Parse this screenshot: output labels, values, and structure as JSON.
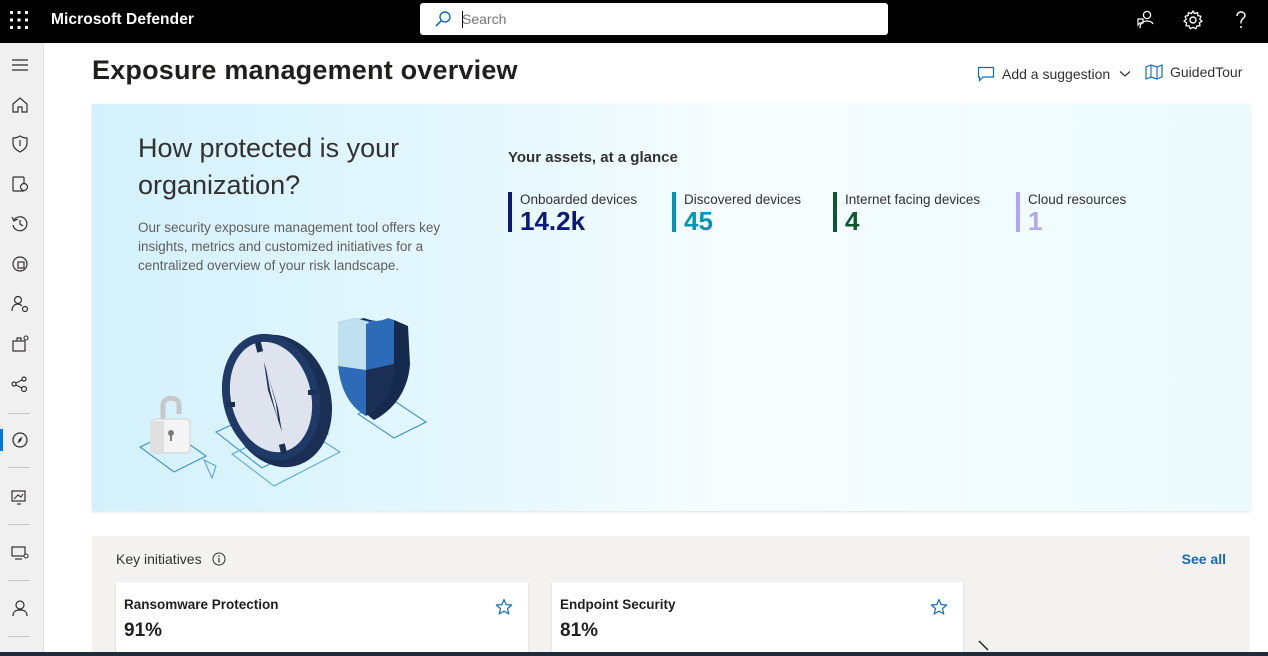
{
  "app": {
    "name": "Microsoft Defender"
  },
  "search": {
    "placeholder": "Search"
  },
  "topbar_icons": [
    "community-icon",
    "settings-icon",
    "help-icon"
  ],
  "rail_icons": [
    "menu-icon",
    "home-icon",
    "shield-icon",
    "assets-icon",
    "history-icon",
    "cloud-apps-icon",
    "identity-icon",
    "hunting-icon",
    "graph-icon",
    "exposure-icon",
    "reports-icon",
    "devices-icon",
    "user-icon"
  ],
  "header": {
    "title": "Exposure management overview",
    "suggestion_label": "Add a suggestion",
    "tour_label": "GuidedTour"
  },
  "hero": {
    "title": "How protected is your organization?",
    "description": "Our security exposure management tool offers key insights, metrics and customized initiatives for a centralized overview of your risk landscape.",
    "glance_title": "Your assets, at a glance",
    "metrics": [
      {
        "label": "Onboarded devices",
        "value": "14.2k",
        "color": "#0b1a7a"
      },
      {
        "label": "Discovered devices",
        "value": "45",
        "color": "#0096b4"
      },
      {
        "label": "Internet facing devices",
        "value": "4",
        "color": "#0b5a2e"
      },
      {
        "label": "Cloud resources",
        "value": "1",
        "color": "#b4a7f0"
      }
    ]
  },
  "key_initiatives": {
    "title": "Key initiatives",
    "see_all": "See all",
    "cards": [
      {
        "name": "Ransomware Protection",
        "value": "91%"
      },
      {
        "name": "Endpoint Security",
        "value": "81%"
      }
    ]
  },
  "colors": {
    "accent": "#0078d4",
    "link": "#0f6cbd",
    "topbar": "#000000"
  }
}
